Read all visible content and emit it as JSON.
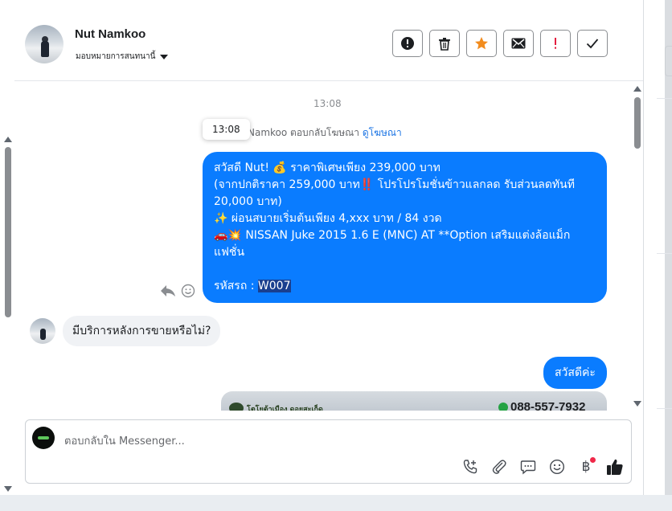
{
  "header": {
    "contact_name": "Nut Namkoo",
    "assign_label": "มอบหมายการสนทนานี้",
    "actions": [
      {
        "name": "spam-button",
        "icon": "exclamation-circle-icon"
      },
      {
        "name": "delete-button",
        "icon": "trash-icon"
      },
      {
        "name": "star-button",
        "icon": "star-icon"
      },
      {
        "name": "mark-unread-button",
        "icon": "envelope-icon"
      },
      {
        "name": "follow-up-button",
        "icon": "exclamation-icon"
      },
      {
        "name": "done-button",
        "icon": "check-icon"
      }
    ],
    "accent_star": "#f28c1e",
    "accent_alert": "#e41e3f"
  },
  "conversation": {
    "timestamp": "13:08",
    "tooltip": "13:08",
    "reply_note": "Namkoo ตอบกลับโฆษณา",
    "reply_note_link": "ดูโฆษณา",
    "outgoing_message": {
      "line1": "สวัสดี Nut! 💰 ราคาพิเศษเพียง 239,000 บาท",
      "line2": "(จากปกติราคา 259,000 บาท‼️ โปรโปรโมชั่นข้าวแลกลด รับส่วนลดทันที 20,000 บาท)",
      "line3": "✨ ผ่อนสบายเริ่มต้นเพียง 4,xxx บาท / 84 งวด",
      "line4": "🚗💥 NISSAN Juke 2015 1.6 E (MNC) AT **Option เสริมแต่งล้อแม็กแฟชั่น",
      "code_label": "รหัสรถ :",
      "code_value": "W007"
    },
    "incoming_message": "มีบริการหลังการขายหรือไม่?",
    "outgoing_greeting": "สวัสดีค่ะ",
    "image_card": {
      "brand": "โตโยต้าเมือง ดอยสะเก็ด",
      "phone": "088-557-7932"
    },
    "bubble_color": "#0a7cff"
  },
  "composer": {
    "placeholder": "ตอบกลับใน Messenger...",
    "tools": [
      {
        "name": "call-add-icon"
      },
      {
        "name": "attach-icon"
      },
      {
        "name": "saved-reply-icon"
      },
      {
        "name": "emoji-icon"
      },
      {
        "name": "payment-baht-icon",
        "label": "฿"
      },
      {
        "name": "like-icon"
      }
    ]
  }
}
